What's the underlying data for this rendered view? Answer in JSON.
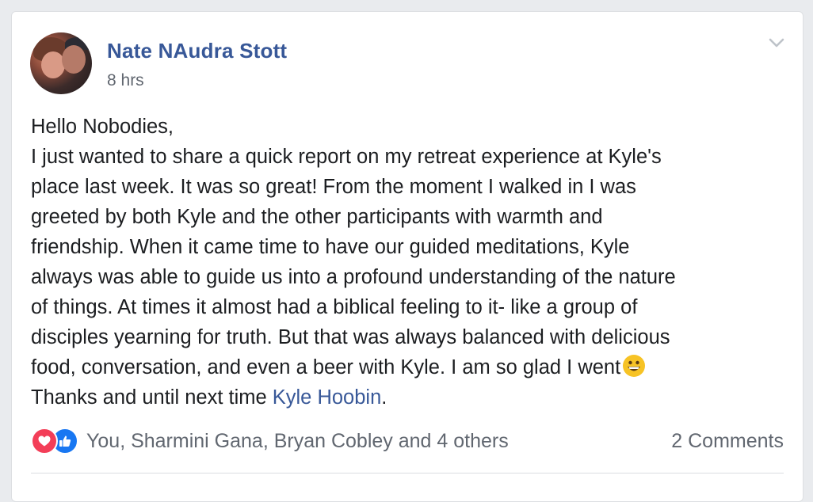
{
  "post": {
    "author": "Nate NAudra Stott",
    "time": "8 hrs",
    "greeting": "Hello Nobodies,",
    "lines": [
      "I just wanted to share a quick report on my retreat experience at Kyle's",
      "place last week. It was so great! From the moment I walked in I was",
      "greeted by both Kyle and the other participants with warmth and",
      "friendship. When it came time to have our guided meditations, Kyle",
      "always was able to guide us into a profound understanding of the nature",
      "of things. At times it almost had a biblical feeling to it- like a group of",
      "disciples yearning for truth. But that was always balanced with delicious"
    ],
    "line_emoji": "food, conversation, and even a beer with Kyle. I am so glad I went",
    "closing_prefix": "Thanks and until next time ",
    "mention": "Kyle Hoobin",
    "closing_suffix": "."
  },
  "footer": {
    "reactions_text": "You, Sharmini Gana, Bryan Cobley and 4 others",
    "comments_text": "2 Comments"
  },
  "icons": {
    "menu": "chevron-down-icon",
    "love": "heart-icon",
    "like": "thumbs-up-icon",
    "emoji": "grinning-face-icon"
  },
  "colors": {
    "link": "#385898",
    "love": "#f33e58",
    "like": "#1877f2",
    "muted": "#616770"
  }
}
